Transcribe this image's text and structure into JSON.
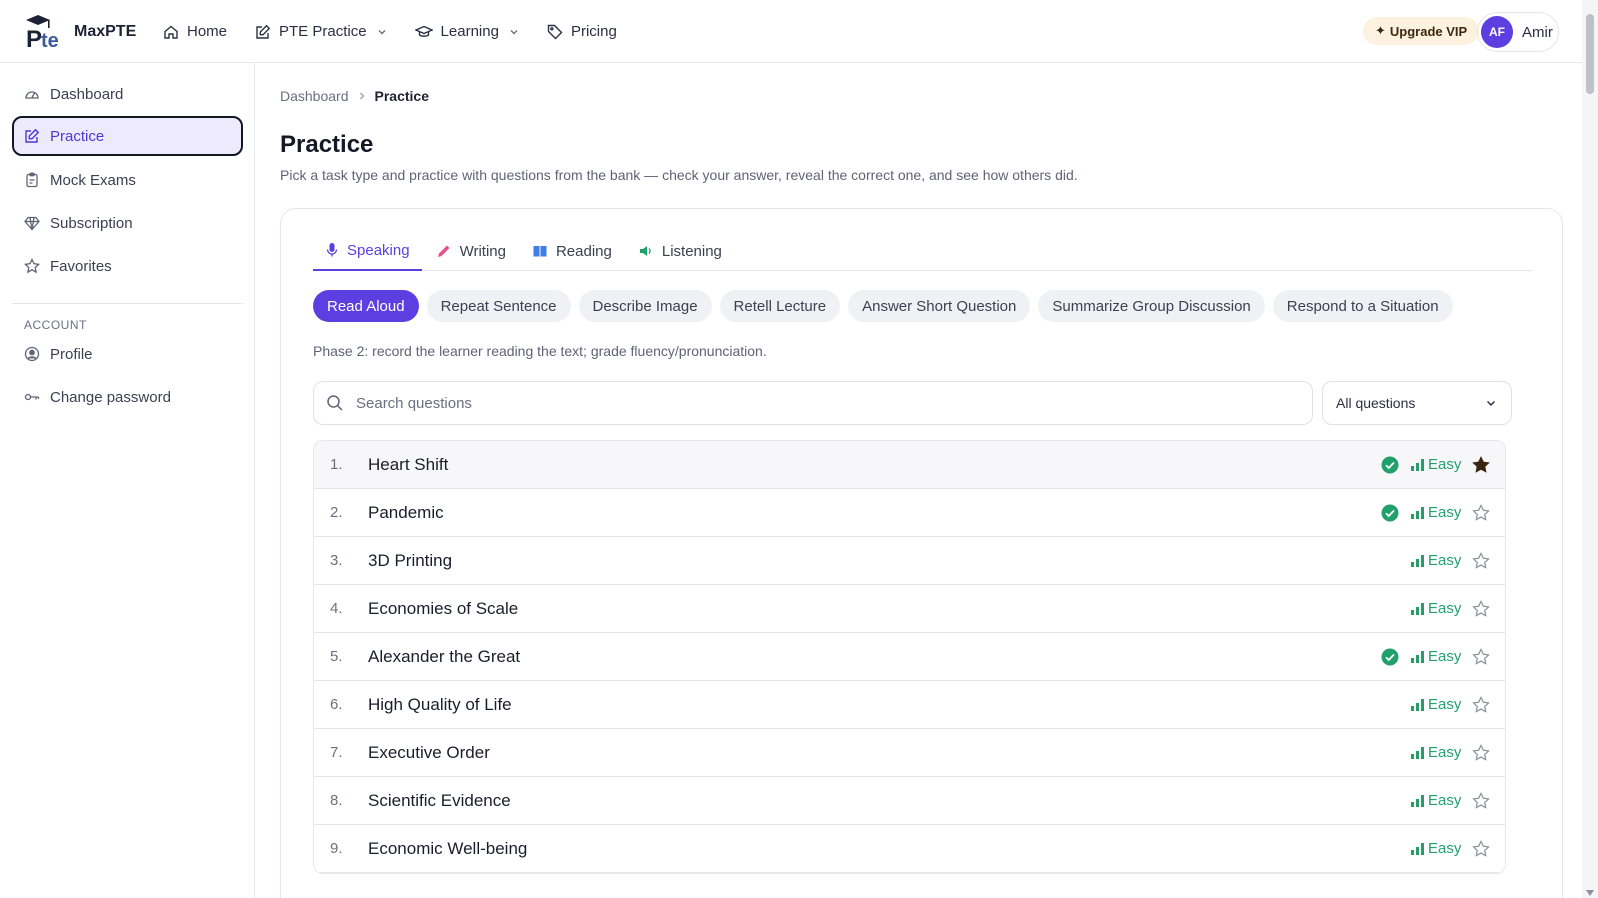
{
  "header": {
    "brand": "MaxPTE",
    "nav": [
      {
        "label": "Home"
      },
      {
        "label": "PTE Practice"
      },
      {
        "label": "Learning"
      },
      {
        "label": "Pricing"
      }
    ],
    "upgrade_label": "Upgrade VIP",
    "user": {
      "initials": "AF",
      "name": "Amir"
    }
  },
  "sidebar": {
    "items": [
      {
        "label": "Dashboard"
      },
      {
        "label": "Practice"
      },
      {
        "label": "Mock Exams"
      },
      {
        "label": "Subscription"
      },
      {
        "label": "Favorites"
      }
    ],
    "section_label": "ACCOUNT",
    "account_items": [
      {
        "label": "Profile"
      },
      {
        "label": "Change password"
      }
    ]
  },
  "breadcrumb": {
    "root": "Dashboard",
    "current": "Practice"
  },
  "page": {
    "title": "Practice",
    "description": "Pick a task type and practice with questions from the bank — check your answer, reveal the correct one, and see how others did."
  },
  "tabs": [
    {
      "label": "Speaking"
    },
    {
      "label": "Writing"
    },
    {
      "label": "Reading"
    },
    {
      "label": "Listening"
    }
  ],
  "task_chips": [
    {
      "label": "Read Aloud"
    },
    {
      "label": "Repeat Sentence"
    },
    {
      "label": "Describe Image"
    },
    {
      "label": "Retell Lecture"
    },
    {
      "label": "Answer Short Question"
    },
    {
      "label": "Summarize Group Discussion"
    },
    {
      "label": "Respond to a Situation"
    }
  ],
  "phase_text": "Phase 2: record the learner reading the text; grade fluency/pronunciation.",
  "search": {
    "placeholder": "Search questions"
  },
  "filter": {
    "selected": "All questions"
  },
  "questions": [
    {
      "num": "1.",
      "title": "Heart Shift",
      "done": true,
      "difficulty": "Easy",
      "favorite": true
    },
    {
      "num": "2.",
      "title": "Pandemic",
      "done": true,
      "difficulty": "Easy",
      "favorite": false
    },
    {
      "num": "3.",
      "title": "3D Printing",
      "done": false,
      "difficulty": "Easy",
      "favorite": false
    },
    {
      "num": "4.",
      "title": "Economies of Scale",
      "done": false,
      "difficulty": "Easy",
      "favorite": false
    },
    {
      "num": "5.",
      "title": "Alexander the Great",
      "done": true,
      "difficulty": "Easy",
      "favorite": false
    },
    {
      "num": "6.",
      "title": "High Quality of Life",
      "done": false,
      "difficulty": "Easy",
      "favorite": false
    },
    {
      "num": "7.",
      "title": "Executive Order",
      "done": false,
      "difficulty": "Easy",
      "favorite": false
    },
    {
      "num": "8.",
      "title": "Scientific Evidence",
      "done": false,
      "difficulty": "Easy",
      "favorite": false
    },
    {
      "num": "9.",
      "title": "Economic Well-being",
      "done": false,
      "difficulty": "Easy",
      "favorite": false
    }
  ],
  "colors": {
    "accent": "#5b3fe0",
    "accent_light": "#eeeafd",
    "success": "#22a06b",
    "upgrade_bg": "#fdf2df"
  }
}
